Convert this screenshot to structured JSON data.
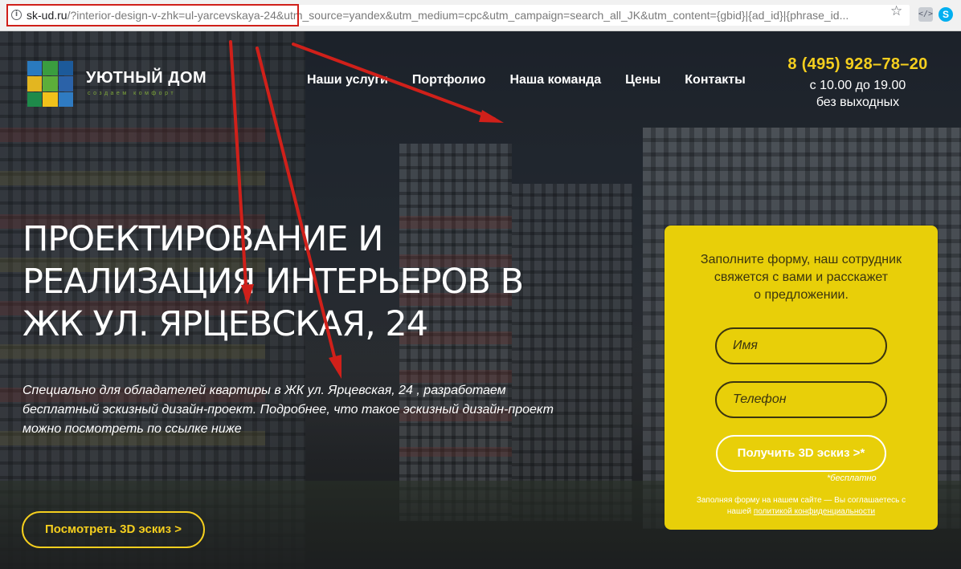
{
  "browser": {
    "url_host": "sk-ud.ru",
    "url_path": "/?interior-design-v-zhk=ul-yarcevskaya-24&utm_source=yandex&utm_medium=cpc&utm_campaign=search_all_JK&utm_content={gbid}|{ad_id}|{phrase_id...",
    "info_icon": "i",
    "star_icon": "☆",
    "ext_code_icon": "</>",
    "ext_skype_icon": "S"
  },
  "logo": {
    "title": "УЮТНЫЙ ДОМ",
    "subtitle": "создаем комфорт",
    "colors": [
      "#2a7abf",
      "#3a9d3f",
      "#1c5a9a",
      "#e3b620",
      "#5cae3a",
      "#2b62a8",
      "#1e8a4a",
      "#f1c21b",
      "#2f7bc2"
    ]
  },
  "nav": {
    "items": [
      "Наши услуги",
      "Портфолио",
      "Наша команда",
      "Цены",
      "Контакты"
    ]
  },
  "contact": {
    "phone": "8 (495) 928–78–20",
    "hours_line1": "с 10.00 до 19.00",
    "hours_line2": "без выходных"
  },
  "hero": {
    "headline_lines": [
      "ПРОЕКТИРОВАНИЕ И",
      "РЕАЛИЗАЦИЯ ИНТЕРЬЕРОВ В",
      "ЖК УЛ. ЯРЦЕВСКАЯ, 24"
    ],
    "lead_lines": [
      "Специально для обладателей квартиры в ЖК ул. Ярцевская, 24 , разработаем",
      "бесплатный эскизный дизайн-проект. Подробнее, что такое эскизный дизайн-проект",
      "можно посмотреть по ссылке ниже"
    ],
    "cta_label": "Посмотреть 3D эскиз >"
  },
  "form": {
    "intro_lines": [
      "Заполните форму, наш сотрудник",
      "свяжется с вами и расскажет",
      "о предложении."
    ],
    "name_placeholder": "Имя",
    "phone_placeholder": "Телефон",
    "submit_label": "Получить 3D эскиз >*",
    "free_note": "*бесплатно",
    "consent_line1": "Заполняя форму на нашем сайте — Вы соглашаетесь с",
    "consent_prefix": "нашей",
    "consent_link": "политикой конфиденциальности"
  },
  "colors": {
    "accent_yellow": "#f5cf1e",
    "form_bg": "#e8cf09",
    "annotation_red": "#d0201a"
  }
}
